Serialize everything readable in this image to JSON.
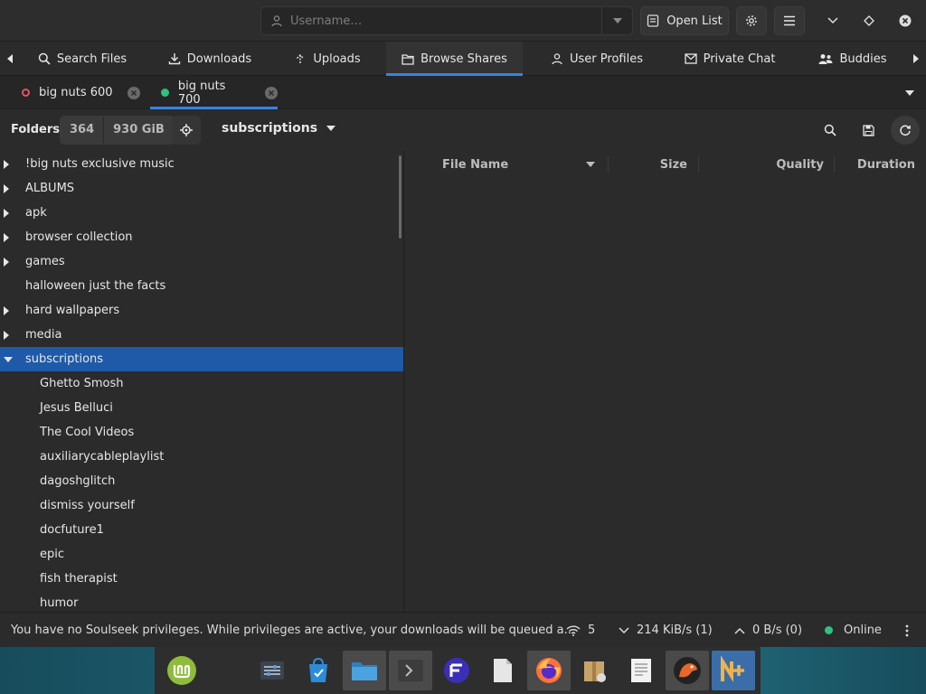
{
  "header": {
    "username_placeholder": "Username…",
    "open_list_label": "Open List"
  },
  "tabs": [
    {
      "label": "Search Files",
      "icon": "search-icon"
    },
    {
      "label": "Downloads",
      "icon": "download-icon"
    },
    {
      "label": "Uploads",
      "icon": "upload-icon"
    },
    {
      "label": "Browse Shares",
      "icon": "folder-icon",
      "active": true
    },
    {
      "label": "User Profiles",
      "icon": "user-icon"
    },
    {
      "label": "Private Chat",
      "icon": "mail-icon"
    },
    {
      "label": "Buddies",
      "icon": "people-icon"
    }
  ],
  "user_tabs": [
    {
      "label": "big nuts 600",
      "status": "offline"
    },
    {
      "label": "big nuts 700",
      "status": "online",
      "active": true
    }
  ],
  "toolbar": {
    "folders_label": "Folders",
    "folder_count": "364",
    "total_size": "930 GiB",
    "current_folder": "subscriptions"
  },
  "tree": {
    "folders": [
      {
        "label": "!big nuts exclusive music",
        "expandable": true
      },
      {
        "label": "ALBUMS",
        "expandable": true
      },
      {
        "label": "apk",
        "expandable": true
      },
      {
        "label": "browser collection",
        "expandable": true
      },
      {
        "label": "games",
        "expandable": true
      },
      {
        "label": "halloween just the facts",
        "expandable": false
      },
      {
        "label": "hard wallpapers",
        "expandable": true
      },
      {
        "label": "media",
        "expandable": true
      },
      {
        "label": "subscriptions",
        "expandable": true,
        "expanded": true,
        "selected": true
      }
    ],
    "children": [
      "Ghetto Smosh",
      "Jesus Belluci",
      "The Cool Videos",
      "auxiliarycableplaylist",
      "dagoshglitch",
      "dismiss yourself",
      "docfuture1",
      "epic",
      "fish therapist",
      "humor"
    ]
  },
  "file_columns": {
    "name": "File Name",
    "size": "Size",
    "quality": "Quality",
    "duration": "Duration"
  },
  "statusbar": {
    "message": "You have no Soulseek privileges. While privileges are active, your downloads will be queued a...",
    "connections": "5",
    "download_speed": "214 KiB/s (1)",
    "upload_speed": "0 B/s (0)",
    "status": "Online"
  },
  "colors": {
    "accent": "#3584e4",
    "selection": "#1e5aa8",
    "online": "#2ec27e",
    "offline": "#e05565"
  },
  "taskbar": {
    "apps": [
      "mint-menu-icon",
      "settings-icon",
      "software-manager-icon",
      "files-icon",
      "terminal-icon",
      "app-f-icon",
      "blank-file-icon",
      "firefox-icon",
      "archive-icon",
      "text-editor-icon",
      "bird-app-icon",
      "nicotine-icon"
    ]
  }
}
